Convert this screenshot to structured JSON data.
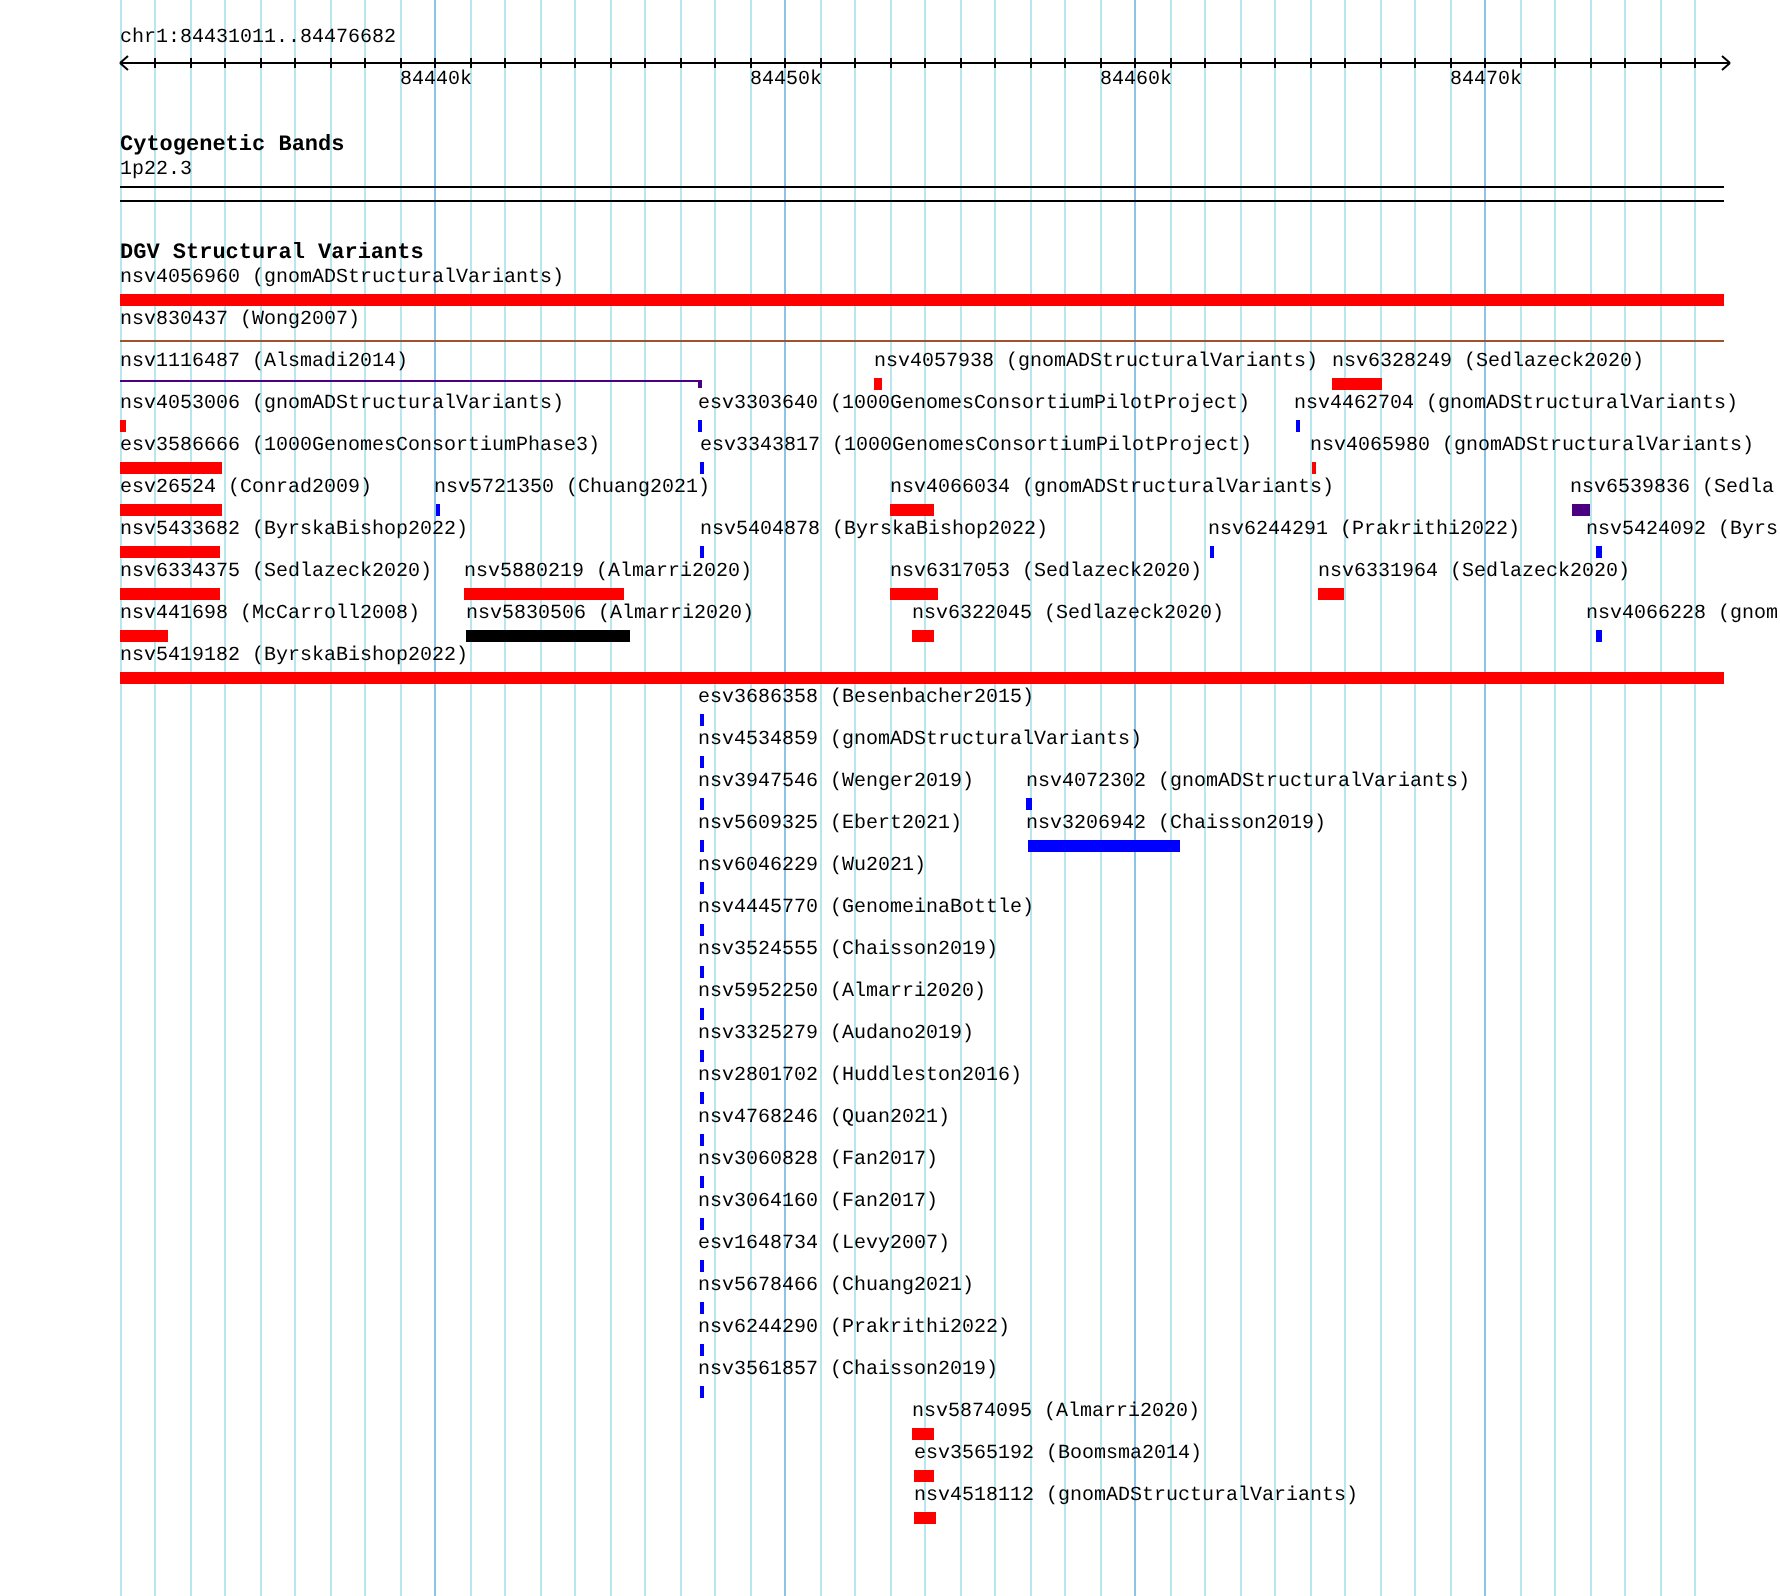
{
  "location": "chr1:84431011..84476682",
  "ruler": {
    "ticks": [
      "84440k",
      "84450k",
      "84460k",
      "84470k"
    ]
  },
  "tracks": [
    {
      "title": "Cytogenetic Bands",
      "band": "1p22.3"
    },
    {
      "title": "DGV Structural Variants",
      "features": [
        {
          "label": "nsv4056960 (gnomADStructuralVariants)",
          "kind": "bar",
          "color": "#ff0000"
        },
        {
          "label": "nsv830437 (Wong2007)",
          "kind": "line",
          "color": "#a0522d"
        },
        {
          "label": "nsv1116487 (Alsmadi2014)",
          "kind": "line",
          "color": "#4b0082"
        },
        {
          "label": "nsv4057938 (gnomADStructuralVariants)",
          "kind": "bar",
          "color": "#ff0000"
        },
        {
          "label": "nsv6328249 (Sedlazeck2020)",
          "kind": "bar",
          "color": "#ff0000"
        },
        {
          "label": "nsv4053006 (gnomADStructuralVariants)",
          "kind": "bar",
          "color": "#ff0000"
        },
        {
          "label": "esv3303640 (1000GenomesConsortiumPilotProject)",
          "kind": "bar",
          "color": "#0000ff"
        },
        {
          "label": "nsv4462704 (gnomADStructuralVariants)",
          "kind": "bar",
          "color": "#0000ff"
        },
        {
          "label": "esv3586666 (1000GenomesConsortiumPhase3)",
          "kind": "bar",
          "color": "#ff0000"
        },
        {
          "label": "esv3343817 (1000GenomesConsortiumPilotProject)",
          "kind": "bar",
          "color": "#0000ff"
        },
        {
          "label": "nsv4065980 (gnomADStructuralVariants)",
          "kind": "bar",
          "color": "#ff0000"
        },
        {
          "label": "esv26524 (Conrad2009)",
          "kind": "bar",
          "color": "#ff0000"
        },
        {
          "label": "nsv5721350 (Chuang2021)",
          "kind": "bar",
          "color": "#0000ff"
        },
        {
          "label": "nsv4066034 (gnomADStructuralVariants)",
          "kind": "bar",
          "color": "#ff0000"
        },
        {
          "label": "nsv6539836 (Sedla",
          "kind": "bar",
          "color": "#4b0082"
        },
        {
          "label": "nsv5433682 (ByrskaBishop2022)",
          "kind": "bar",
          "color": "#ff0000"
        },
        {
          "label": "nsv5404878 (ByrskaBishop2022)",
          "kind": "bar",
          "color": "#0000ff"
        },
        {
          "label": "nsv6244291 (Prakrithi2022)",
          "kind": "bar",
          "color": "#0000ff"
        },
        {
          "label": "nsv5424092 (Byrs",
          "kind": "bar",
          "color": "#0000ff"
        },
        {
          "label": "nsv6334375 (Sedlazeck2020)",
          "kind": "bar",
          "color": "#ff0000"
        },
        {
          "label": "nsv5880219 (Almarri2020)",
          "kind": "bar",
          "color": "#ff0000"
        },
        {
          "label": "nsv6317053 (Sedlazeck2020)",
          "kind": "bar",
          "color": "#ff0000"
        },
        {
          "label": "nsv6331964 (Sedlazeck2020)",
          "kind": "bar",
          "color": "#ff0000"
        },
        {
          "label": "nsv441698 (McCarroll2008)",
          "kind": "bar",
          "color": "#ff0000"
        },
        {
          "label": "nsv5830506 (Almarri2020)",
          "kind": "bar",
          "color": "#000000"
        },
        {
          "label": "nsv6322045 (Sedlazeck2020)",
          "kind": "bar",
          "color": "#ff0000"
        },
        {
          "label": "nsv4066228 (gnom",
          "kind": "bar",
          "color": "#0000ff"
        },
        {
          "label": "nsv5419182 (ByrskaBishop2022)",
          "kind": "bar",
          "color": "#ff0000"
        },
        {
          "label": "esv3686358 (Besenbacher2015)",
          "kind": "bar",
          "color": "#0000ff"
        },
        {
          "label": "nsv4534859 (gnomADStructuralVariants)",
          "kind": "bar",
          "color": "#0000ff"
        },
        {
          "label": "nsv3947546 (Wenger2019)",
          "kind": "bar",
          "color": "#0000ff"
        },
        {
          "label": "nsv4072302 (gnomADStructuralVariants)",
          "kind": "bar",
          "color": "#0000ff"
        },
        {
          "label": "nsv5609325 (Ebert2021)",
          "kind": "bar",
          "color": "#0000ff"
        },
        {
          "label": "nsv3206942 (Chaisson2019)",
          "kind": "bar",
          "color": "#0000ff"
        },
        {
          "label": "nsv6046229 (Wu2021)",
          "kind": "bar",
          "color": "#0000ff"
        },
        {
          "label": "nsv4445770 (GenomeinaBottle)",
          "kind": "bar",
          "color": "#0000ff"
        },
        {
          "label": "nsv3524555 (Chaisson2019)",
          "kind": "bar",
          "color": "#0000ff"
        },
        {
          "label": "nsv5952250 (Almarri2020)",
          "kind": "bar",
          "color": "#0000ff"
        },
        {
          "label": "nsv3325279 (Audano2019)",
          "kind": "bar",
          "color": "#0000ff"
        },
        {
          "label": "nsv2801702 (Huddleston2016)",
          "kind": "bar",
          "color": "#0000ff"
        },
        {
          "label": "nsv4768246 (Quan2021)",
          "kind": "bar",
          "color": "#0000ff"
        },
        {
          "label": "nsv3060828 (Fan2017)",
          "kind": "bar",
          "color": "#0000ff"
        },
        {
          "label": "nsv3064160 (Fan2017)",
          "kind": "bar",
          "color": "#0000ff"
        },
        {
          "label": "esv1648734 (Levy2007)",
          "kind": "bar",
          "color": "#0000ff"
        },
        {
          "label": "nsv5678466 (Chuang2021)",
          "kind": "bar",
          "color": "#0000ff"
        },
        {
          "label": "nsv6244290 (Prakrithi2022)",
          "kind": "bar",
          "color": "#0000ff"
        },
        {
          "label": "nsv3561857 (Chaisson2019)",
          "kind": "bar",
          "color": "#0000ff"
        },
        {
          "label": "nsv5874095 (Almarri2020)",
          "kind": "bar",
          "color": "#ff0000"
        },
        {
          "label": "esv3565192 (Boomsma2014)",
          "kind": "bar",
          "color": "#ff0000"
        },
        {
          "label": "nsv4518112 (gnomADStructuralVariants)",
          "kind": "bar",
          "color": "#ff0000"
        }
      ]
    }
  ]
}
